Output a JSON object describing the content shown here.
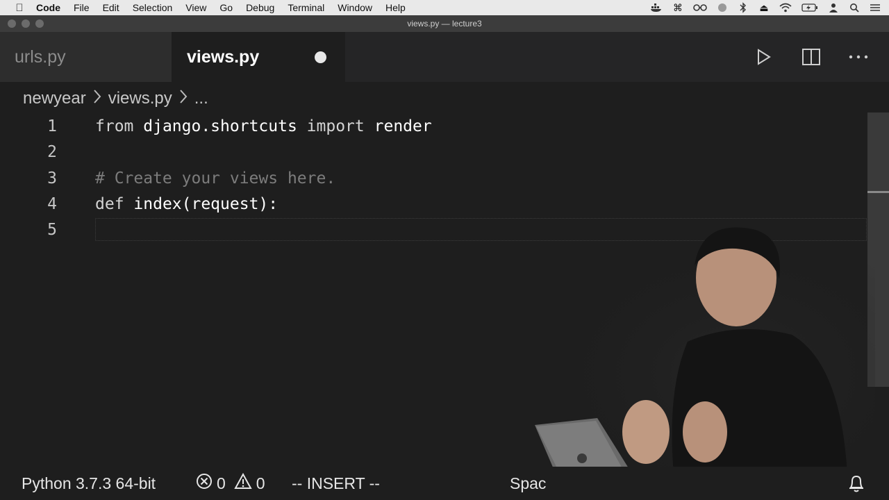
{
  "menubar": {
    "app_name": "Code",
    "items": [
      "File",
      "Edit",
      "Selection",
      "View",
      "Go",
      "Debug",
      "Terminal",
      "Window",
      "Help"
    ],
    "status_icons": [
      "docker-icon",
      "command-icon",
      "glasses-icon",
      "vpn-icon",
      "bluetooth-icon",
      "eject-icon",
      "wifi-icon",
      "battery-icon",
      "user-icon",
      "search-icon",
      "list-icon"
    ]
  },
  "window": {
    "title": "views.py — lecture3"
  },
  "tabs": [
    {
      "label": "urls.py",
      "active": false
    },
    {
      "label": "views.py",
      "active": true,
      "dirty": true
    }
  ],
  "breadcrumb": {
    "folder": "newyear",
    "file": "views.py",
    "more": "..."
  },
  "editor": {
    "lines": [
      {
        "number": "1",
        "tokens": [
          "from",
          "django.shortcuts",
          "import",
          "render"
        ]
      },
      {
        "number": "2"
      },
      {
        "number": "3",
        "comment": "# Create your views here."
      },
      {
        "number": "4",
        "keyword": "def",
        "text": "index(request):"
      },
      {
        "number": "5"
      }
    ]
  },
  "statusbar": {
    "interpreter": "Python 3.7.3 64-bit",
    "errors": "0",
    "warnings": "0",
    "mode": "-- INSERT --",
    "indentation": "Spac"
  },
  "colors": {
    "editor_bg": "#1e1e1e",
    "tabbar_bg": "#252526",
    "inactive_tab_bg": "#2d2d2d",
    "comment": "#7c7c7c",
    "menubar_bg": "#e9e9e9"
  }
}
